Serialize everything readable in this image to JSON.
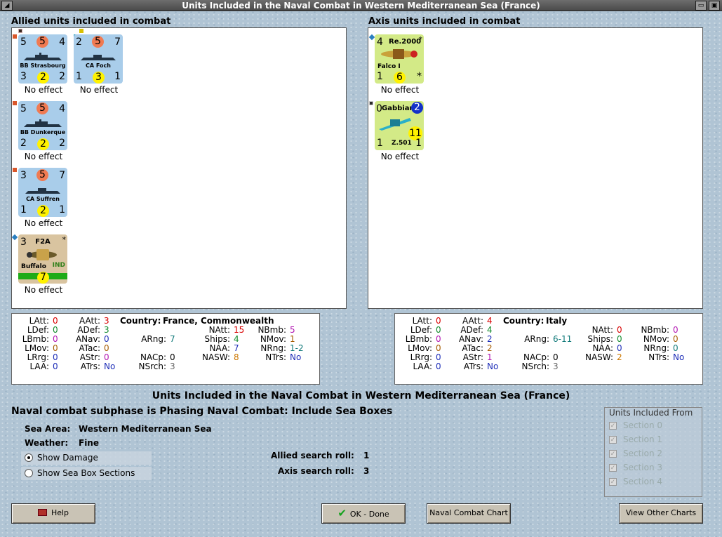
{
  "window": {
    "title": "Units Included in the Naval Combat in Western Mediterranean Sea (France)"
  },
  "allied": {
    "header": "Allied units included in combat",
    "units": [
      {
        "name": "BB Strasbourg",
        "tl": "5",
        "tc": "5",
        "tr": "4",
        "bl": "3",
        "bc": "2",
        "br": "2",
        "effect": "No effect"
      },
      {
        "name": "CA Foch",
        "tl": "2",
        "tc": "5",
        "tr": "7",
        "bl": "1",
        "bc": "3",
        "br": "1",
        "effect": "No effect"
      },
      {
        "name": "BB Dunkerque",
        "tl": "5",
        "tc": "5",
        "tr": "4",
        "bl": "2",
        "bc": "2",
        "br": "2",
        "effect": "No effect"
      },
      {
        "name": "CA Suffren",
        "tl": "3",
        "tc": "5",
        "tr": "7",
        "bl": "1",
        "bc": "2",
        "br": "1",
        "effect": "No effect"
      },
      {
        "type": "F2A",
        "name": "Buffalo",
        "tl": "3",
        "star": "*",
        "nat": "IND",
        "bc": "7",
        "effect": "No effect"
      }
    ]
  },
  "axis": {
    "header": "Axis units included in combat",
    "units": [
      {
        "type": "Re.2000",
        "name": "Falco I",
        "tl": "4",
        "star": "*",
        "bl": "1",
        "bc": "6",
        "br": "*",
        "effect": "No effect"
      },
      {
        "type": "Gabbiano",
        "name": "Z.501",
        "tl": "0",
        "tc": "2",
        "bl": "1",
        "bc": "11",
        "br": "1",
        "effect": "No effect"
      }
    ]
  },
  "allied_stats": {
    "latt_l": "LAtt:",
    "latt": "0",
    "ldef_l": "LDef:",
    "ldef": "0",
    "lbmb_l": "LBmb:",
    "lbmb": "0",
    "lmov_l": "LMov:",
    "lmov": "0",
    "lrrg_l": "LRrg:",
    "lrrg": "0",
    "laa_l": "LAA:",
    "laa": "0",
    "aatt_l": "AAtt:",
    "aatt": "3",
    "adef_l": "ADef:",
    "adef": "3",
    "anav_l": "ANav:",
    "anav": "0",
    "atac_l": "ATac:",
    "atac": "0",
    "astr_l": "AStr:",
    "astr": "0",
    "atrs_l": "ATrs:",
    "atrs": "No",
    "country_l": "Country:",
    "country": "France, Commonwealth",
    "arng_l": "ARng:",
    "arng": "7",
    "nacp_l": "NACp:",
    "nacp": "0",
    "nsrch_l": "NSrch:",
    "nsrch": "3",
    "natt_l": "NAtt:",
    "natt": "15",
    "ships_l": "Ships:",
    "ships": "4",
    "naa_l": "NAA:",
    "naa": "7",
    "nasw_l": "NASW:",
    "nasw": "8",
    "nbmb_l": "NBmb:",
    "nbmb": "5",
    "nmov_l": "NMov:",
    "nmov": "1",
    "nrng_l": "NRng:",
    "nrng": "1-2",
    "ntrs_l": "NTrs:",
    "ntrs": "No"
  },
  "axis_stats": {
    "latt_l": "LAtt:",
    "latt": "0",
    "ldef_l": "LDef:",
    "ldef": "0",
    "lbmb_l": "LBmb:",
    "lbmb": "0",
    "lmov_l": "LMov:",
    "lmov": "0",
    "lrrg_l": "LRrg:",
    "lrrg": "0",
    "laa_l": "LAA:",
    "laa": "0",
    "aatt_l": "AAtt:",
    "aatt": "4",
    "adef_l": "ADef:",
    "adef": "4",
    "anav_l": "ANav:",
    "anav": "2",
    "atac_l": "ATac:",
    "atac": "2",
    "astr_l": "AStr:",
    "astr": "1",
    "atrs_l": "ATrs:",
    "atrs": "No",
    "country_l": "Country:",
    "country": "Italy",
    "arng_l": "ARng:",
    "arng": "6-11",
    "nacp_l": "NACp:",
    "nacp": "0",
    "nsrch_l": "NSrch:",
    "nsrch": "3",
    "natt_l": "NAtt:",
    "natt": "0",
    "ships_l": "Ships:",
    "ships": "0",
    "naa_l": "NAA:",
    "naa": "0",
    "nasw_l": "NASW:",
    "nasw": "2",
    "nbmb_l": "NBmb:",
    "nbmb": "0",
    "nmov_l": "NMov:",
    "nmov": "0",
    "nrng_l": "NRng:",
    "nrng": "0",
    "ntrs_l": "NTrs:",
    "ntrs": "No"
  },
  "main": {
    "heading": "Units Included in the Naval Combat in Western Mediterranean Sea (France)",
    "subphase": "Naval combat subphase is Phasing Naval Combat: Include Sea Boxes",
    "sea_area_label": "Sea Area:",
    "sea_area": "Western Mediterranean Sea",
    "weather_label": "Weather:",
    "weather": "Fine",
    "allied_roll_label": "Allied search roll:",
    "allied_roll": "1",
    "axis_roll_label": "Axis search roll:",
    "axis_roll": "3"
  },
  "options": {
    "show_damage": "Show Damage",
    "show_sections": "Show Sea Box Sections"
  },
  "included_from": {
    "title": "Units Included From",
    "sections": [
      "Section 0",
      "Section 1",
      "Section 2",
      "Section 3",
      "Section 4"
    ]
  },
  "buttons": {
    "help": "Help",
    "ok": "OK - Done",
    "chart": "Naval Combat Chart",
    "other": "View Other Charts"
  },
  "colors": {
    "naval_counter": "#a9cdea",
    "air_fr": "#d9c4a0",
    "air_it": "#d3ea87",
    "attack_circle": "#f07a52",
    "defense_circle": "#fff200",
    "range_circle": "#1432c8"
  }
}
